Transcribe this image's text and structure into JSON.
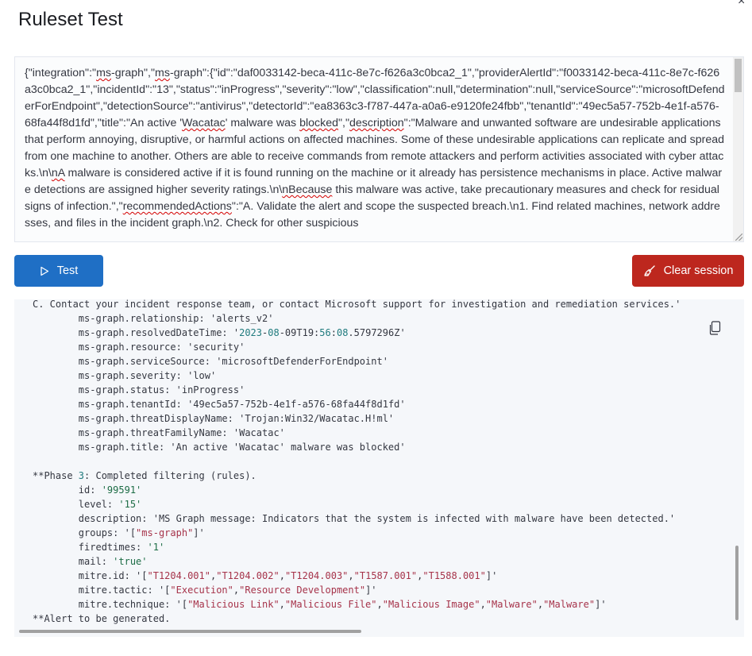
{
  "modal": {
    "title": "Ruleset Test",
    "close_label": "×"
  },
  "input": {
    "value": "{\"integration\":\"ms-graph\",\"ms-graph\":{\"id\":\"daf0033142-beca-411c-8e7c-f626a3c0bca2_1\",\"providerAlertId\":\"f0033142-beca-411c-8e7c-f626a3c0bca2_1\",\"incidentId\":\"13\",\"status\":\"inProgress\",\"severity\":\"low\",\"classification\":null,\"determination\":null,\"serviceSource\":\"microsoftDefenderForEndpoint\",\"detectionSource\":\"antivirus\",\"detectorId\":\"ea8363c3-f787-447a-a0a6-e9120fe24fbb\",\"tenantId\":\"49ec5a57-752b-4e1f-a576-68fa44f8d1fd\",\"title\":\"An active 'Wacatac' malware was blocked\",\"description\":\"Malware and unwanted software are undesirable applications that perform annoying, disruptive, or harmful actions on affected machines. Some of these undesirable applications can replicate and spread from one machine to another. Others are able to receive commands from remote attackers and perform activities associated with cyber attacks.\\n\\nA malware is considered active if it is found running on the machine or it already has persistence mechanisms in place. Active malware detections are assigned higher severity ratings.\\n\\nBecause this malware was active, take precautionary measures and check for residual signs of infection.\",\"recommendedActions\":\"A. Validate the alert and scope the suspected breach.\\n1. Find related machines, network addresses, and files in the incident graph.\\n2. Check for other suspicious"
  },
  "buttons": {
    "test_label": "Test",
    "clear_label": "Clear session"
  },
  "output": {
    "lines": [
      {
        "indent": 0,
        "segments": [
          {
            "t": "C. Contact your incident response team, or contact Microsoft support for investigation and remediation services.'",
            "c": ""
          }
        ]
      },
      {
        "indent": 1,
        "segments": [
          {
            "t": "ms-graph.relationship: ",
            "c": ""
          },
          {
            "t": "'alerts_v2'",
            "c": ""
          }
        ]
      },
      {
        "indent": 1,
        "segments": [
          {
            "t": "ms-graph.resolvedDateTime: ",
            "c": ""
          },
          {
            "t": "'",
            "c": ""
          },
          {
            "t": "2023",
            "c": "num"
          },
          {
            "t": "-",
            "c": ""
          },
          {
            "t": "08",
            "c": "num"
          },
          {
            "t": "-09T19:",
            "c": ""
          },
          {
            "t": "56",
            "c": "num"
          },
          {
            "t": ":",
            "c": ""
          },
          {
            "t": "08",
            "c": "num"
          },
          {
            "t": ".5797296Z'",
            "c": ""
          }
        ]
      },
      {
        "indent": 1,
        "segments": [
          {
            "t": "ms-graph.resource: ",
            "c": ""
          },
          {
            "t": "'security'",
            "c": ""
          }
        ]
      },
      {
        "indent": 1,
        "segments": [
          {
            "t": "ms-graph.serviceSource: ",
            "c": ""
          },
          {
            "t": "'microsoftDefenderForEndpoint'",
            "c": ""
          }
        ]
      },
      {
        "indent": 1,
        "segments": [
          {
            "t": "ms-graph.severity: ",
            "c": ""
          },
          {
            "t": "'low'",
            "c": ""
          }
        ]
      },
      {
        "indent": 1,
        "segments": [
          {
            "t": "ms-graph.status: ",
            "c": ""
          },
          {
            "t": "'inProgress'",
            "c": ""
          }
        ]
      },
      {
        "indent": 1,
        "segments": [
          {
            "t": "ms-graph.tenantId: ",
            "c": ""
          },
          {
            "t": "'49ec5a57-752b-4e1f-a576-68fa44f8d1fd'",
            "c": ""
          }
        ]
      },
      {
        "indent": 1,
        "segments": [
          {
            "t": "ms-graph.threatDisplayName: ",
            "c": ""
          },
          {
            "t": "'Trojan:Win32/Wacatac.H!ml'",
            "c": ""
          }
        ]
      },
      {
        "indent": 1,
        "segments": [
          {
            "t": "ms-graph.threatFamilyName: ",
            "c": ""
          },
          {
            "t": "'Wacatac'",
            "c": ""
          }
        ]
      },
      {
        "indent": 1,
        "segments": [
          {
            "t": "ms-graph.title: ",
            "c": ""
          },
          {
            "t": "'An active 'Wacatac' malware was blocked'",
            "c": ""
          }
        ]
      },
      {
        "indent": 0,
        "segments": [
          {
            "t": "",
            "c": ""
          }
        ]
      },
      {
        "indent": 0,
        "segments": [
          {
            "t": "**Phase ",
            "c": ""
          },
          {
            "t": "3",
            "c": "num"
          },
          {
            "t": ": Completed filtering (rules).",
            "c": ""
          }
        ]
      },
      {
        "indent": 1,
        "segments": [
          {
            "t": "id: ",
            "c": ""
          },
          {
            "t": "'99591'",
            "c": "str"
          }
        ]
      },
      {
        "indent": 1,
        "segments": [
          {
            "t": "level: ",
            "c": ""
          },
          {
            "t": "'15'",
            "c": "str"
          }
        ]
      },
      {
        "indent": 1,
        "segments": [
          {
            "t": "description: ",
            "c": ""
          },
          {
            "t": "'MS Graph message: Indicators that the system is infected with malware have been detected.'",
            "c": ""
          }
        ]
      },
      {
        "indent": 1,
        "segments": [
          {
            "t": "groups: ",
            "c": ""
          },
          {
            "t": "'[",
            "c": ""
          },
          {
            "t": "\"ms-graph\"",
            "c": "str2"
          },
          {
            "t": "]'",
            "c": ""
          }
        ]
      },
      {
        "indent": 1,
        "segments": [
          {
            "t": "firedtimes: ",
            "c": ""
          },
          {
            "t": "'1'",
            "c": "str"
          }
        ]
      },
      {
        "indent": 1,
        "segments": [
          {
            "t": "mail: ",
            "c": ""
          },
          {
            "t": "'true'",
            "c": "str"
          }
        ]
      },
      {
        "indent": 1,
        "segments": [
          {
            "t": "mitre.id: ",
            "c": ""
          },
          {
            "t": "'[",
            "c": ""
          },
          {
            "t": "\"T1204.001\"",
            "c": "str2"
          },
          {
            "t": ",",
            "c": ""
          },
          {
            "t": "\"T1204.002\"",
            "c": "str2"
          },
          {
            "t": ",",
            "c": ""
          },
          {
            "t": "\"T1204.003\"",
            "c": "str2"
          },
          {
            "t": ",",
            "c": ""
          },
          {
            "t": "\"T1587.001\"",
            "c": "str2"
          },
          {
            "t": ",",
            "c": ""
          },
          {
            "t": "\"T1588.001\"",
            "c": "str2"
          },
          {
            "t": "]'",
            "c": ""
          }
        ]
      },
      {
        "indent": 1,
        "segments": [
          {
            "t": "mitre.tactic: ",
            "c": ""
          },
          {
            "t": "'[",
            "c": ""
          },
          {
            "t": "\"Execution\"",
            "c": "str2"
          },
          {
            "t": ",",
            "c": ""
          },
          {
            "t": "\"Resource Development\"",
            "c": "str2"
          },
          {
            "t": "]'",
            "c": ""
          }
        ]
      },
      {
        "indent": 1,
        "segments": [
          {
            "t": "mitre.technique: ",
            "c": ""
          },
          {
            "t": "'[",
            "c": ""
          },
          {
            "t": "\"Malicious Link\"",
            "c": "str2"
          },
          {
            "t": ",",
            "c": ""
          },
          {
            "t": "\"Malicious File\"",
            "c": "str2"
          },
          {
            "t": ",",
            "c": ""
          },
          {
            "t": "\"Malicious Image\"",
            "c": "str2"
          },
          {
            "t": ",",
            "c": ""
          },
          {
            "t": "\"Malware\"",
            "c": "str2"
          },
          {
            "t": ",",
            "c": ""
          },
          {
            "t": "\"Malware\"",
            "c": "str2"
          },
          {
            "t": "]'",
            "c": ""
          }
        ]
      },
      {
        "indent": 0,
        "segments": [
          {
            "t": "**Alert to be generated.",
            "c": ""
          }
        ]
      }
    ]
  },
  "colors": {
    "primary": "#1f6fc5",
    "danger": "#bd271e",
    "number": "#207b7e",
    "string": "#1c6c45",
    "json_string": "#a6334a"
  },
  "icons": {
    "test": "play-outline-icon",
    "clear": "broom-icon",
    "copy": "copy-clipboard-icon",
    "close": "close-icon"
  }
}
